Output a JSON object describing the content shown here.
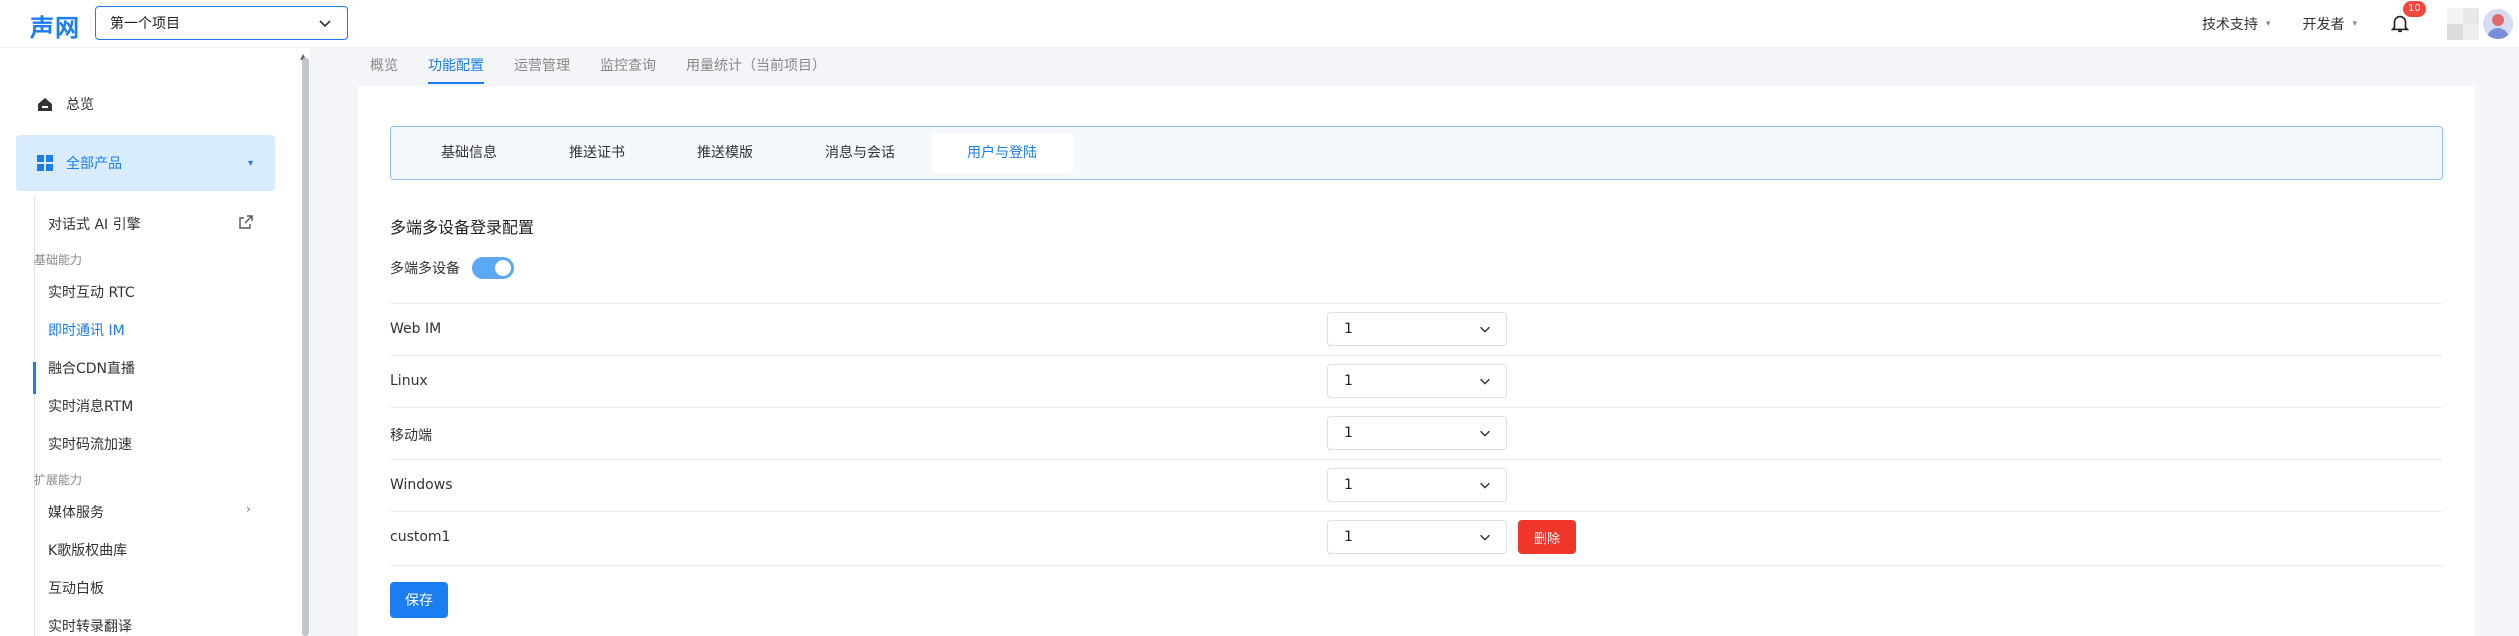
{
  "header": {
    "logo": "声网",
    "project_select": "第一个项目",
    "support_label": "技术支持",
    "developer_label": "开发者",
    "notification_count": "10"
  },
  "sidebar": {
    "overview": "总览",
    "all_products": "全部产品",
    "items": [
      {
        "label": "对话式 AI 引擎"
      },
      {
        "group": "基础能力"
      },
      {
        "label": "实时互动 RTC"
      },
      {
        "label": "即时通讯 IM",
        "active": true
      },
      {
        "label": "融合CDN直播"
      },
      {
        "label": "实时消息RTM"
      },
      {
        "label": "实时码流加速"
      },
      {
        "group": "扩展能力"
      },
      {
        "label": "媒体服务"
      },
      {
        "label": "K歌版权曲库"
      },
      {
        "label": "互动白板"
      },
      {
        "label": "实时转录翻译"
      }
    ]
  },
  "main_tabs": [
    {
      "label": "概览"
    },
    {
      "label": "功能配置",
      "active": true
    },
    {
      "label": "运营管理"
    },
    {
      "label": "监控查询"
    },
    {
      "label": "用量统计（当前项目）"
    }
  ],
  "sub_tabs": [
    {
      "label": "基础信息"
    },
    {
      "label": "推送证书"
    },
    {
      "label": "推送模版"
    },
    {
      "label": "消息与会话"
    },
    {
      "label": "用户与登陆",
      "active": true
    }
  ],
  "config": {
    "title": "多端多设备登录配置",
    "toggle_label": "多端多设备",
    "toggle_on": true,
    "rows": [
      {
        "label": "Web IM",
        "value": "1"
      },
      {
        "label": "Linux",
        "value": "1"
      },
      {
        "label": "移动端",
        "value": "1"
      },
      {
        "label": "Windows",
        "value": "1"
      },
      {
        "label": "custom1",
        "value": "1",
        "delete_label": "删除"
      }
    ],
    "save_label": "保存"
  },
  "colors": {
    "accent": "#1a7ef2",
    "danger": "#f0352b",
    "active_bg": "#d9ecfd"
  }
}
